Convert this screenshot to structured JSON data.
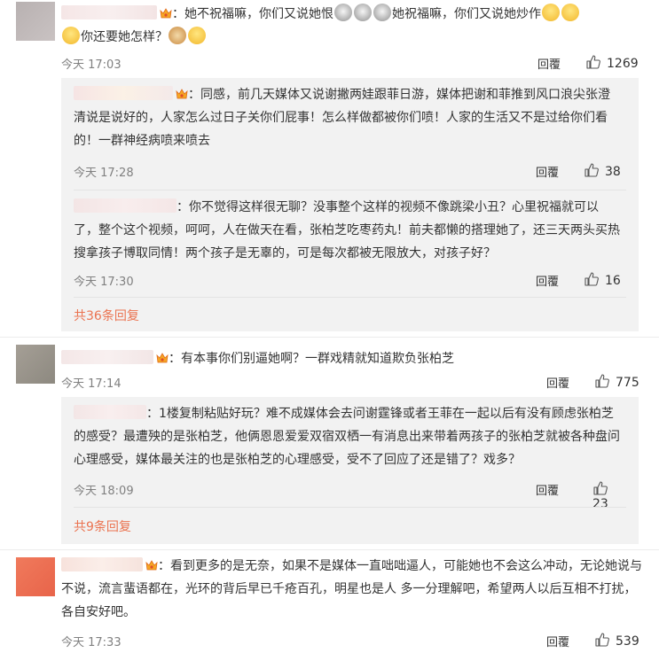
{
  "comments": [
    {
      "text_1": "：她不祝福嘛，你们又说她恨",
      "text_2": "她祝福嘛，你们又说她炒作",
      "text_3": "你还要她怎样？",
      "time": "今天 17:03",
      "reply": "回覆",
      "likes": "1269",
      "sub_comments": [
        {
          "text": "：同感，前几天媒体又说谢撇两娃跟菲日游，媒体把谢和菲推到风口浪尖张澄清说是说好的，人家怎么过日子关你们屁事！怎么样做都被你们喷！人家的生活又不是过给你们看的！一群神经病喷来喷去",
          "time": "今天 17:28",
          "reply": "回覆",
          "likes": "38"
        },
        {
          "text": "：你不觉得这样很无聊？没事整个这样的视频不像跳梁小丑？心里祝福就可以了，整个这个视频，呵呵，人在做天在看，张柏芝吃枣药丸！前夫都懒的搭理她了，还三天两头买热搜拿孩子博取同情！两个孩子是无辜的，可是每次都被无限放大，对孩子好？",
          "time": "今天 17:30",
          "reply": "回覆",
          "likes": "16"
        }
      ],
      "more": "共36条回复"
    },
    {
      "text": "：有本事你们别逼她啊？一群戏精就知道欺负张柏芝",
      "time": "今天 17:14",
      "reply": "回覆",
      "likes": "775",
      "sub_comments": [
        {
          "text": "：1楼复制粘贴好玩？难不成媒体会去问谢霆锋或者王菲在一起以后有没有顾虑张柏芝的感受？最遭殃的是张柏芝，他俩恩恩爱爱双宿双栖一有消息出来带着两孩子的张柏芝就被各种盘问心理感受，媒体最关注的也是张柏芝的心理感受，受不了回应了还是错了？戏多？",
          "time": "今天 18:09",
          "reply": "回覆",
          "likes": "23"
        }
      ],
      "more": "共9条回复"
    },
    {
      "text": "：看到更多的是无奈，如果不是媒体一直咄咄逼人，可能她也不会这么冲动，无论她说与不说，流言蜚语都在，光环的背后早已千疮百孔，明星也是人 多一分理解吧，希望两人以后互相不打扰，各自安好吧。",
      "time": "今天 17:33",
      "reply": "回覆",
      "likes": "539"
    }
  ],
  "icons": {
    "vip": "vip-badge-icon",
    "like": "thumbs-up-icon",
    "emoji_doge": "doge-emoji-icon",
    "emoji_cry": "crying-emoji-icon",
    "emoji_shy": "shy-emoji-icon"
  },
  "colors": {
    "link": "#eb7350",
    "sub_bg": "#f2f2f2",
    "meta": "#808080"
  }
}
